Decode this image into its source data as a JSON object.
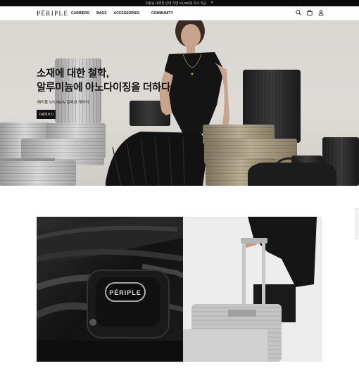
{
  "promo_bar": {
    "text": "회원님 내외분 인데 하면 10,000원 즉시 지급",
    "close_icon": "close-icon"
  },
  "header": {
    "logo": "PÉRIPLE",
    "nav": [
      "CARRIERS",
      "BAGS",
      "ACCESSORIES",
      "COMMUNITY"
    ],
    "icons": [
      "search-icon",
      "bag-icon",
      "user-icon"
    ]
  },
  "hero": {
    "title_line1": "소재에 대한 철학,",
    "title_line2": "알루미늄에 아노다이징을 더하다.",
    "subtitle": "페리플 S/S NEW 컬렉션 캐리어",
    "button_label": "자세히보기"
  },
  "feature": {
    "brand_plate": "PÉRIPLE"
  },
  "colors": {
    "topbar": "#0b0b0b",
    "button": "#111111",
    "hero_bg": "#d9d6d2"
  }
}
